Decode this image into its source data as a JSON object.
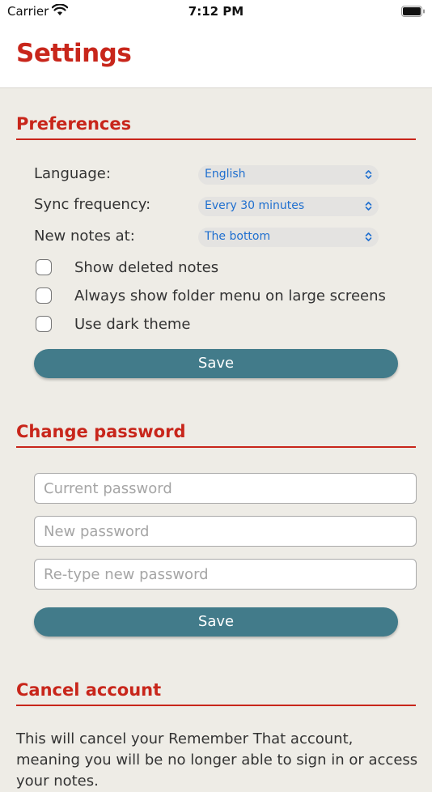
{
  "status_bar": {
    "carrier": "Carrier",
    "time": "7:12 PM"
  },
  "header": {
    "title": "Settings"
  },
  "preferences": {
    "title": "Preferences",
    "language_label": "Language:",
    "language_value": "English",
    "sync_label": "Sync frequency:",
    "sync_value": "Every 30 minutes",
    "new_notes_label": "New notes at:",
    "new_notes_value": "The bottom",
    "checkboxes": [
      {
        "label": "Show deleted notes",
        "checked": false
      },
      {
        "label": "Always show folder menu on large screens",
        "checked": false
      },
      {
        "label": "Use dark theme",
        "checked": false
      }
    ],
    "save_label": "Save"
  },
  "change_password": {
    "title": "Change password",
    "current_placeholder": "Current password",
    "new_placeholder": "New password",
    "retype_placeholder": "Re-type new password",
    "save_label": "Save"
  },
  "cancel_account": {
    "title": "Cancel account",
    "description": "This will cancel your Remember That account, meaning you will be no longer able to sign in or access your notes."
  },
  "colors": {
    "accent": "#c8261b",
    "button": "#427b8a",
    "background": "#eeece6",
    "link": "#1f6fcf"
  }
}
